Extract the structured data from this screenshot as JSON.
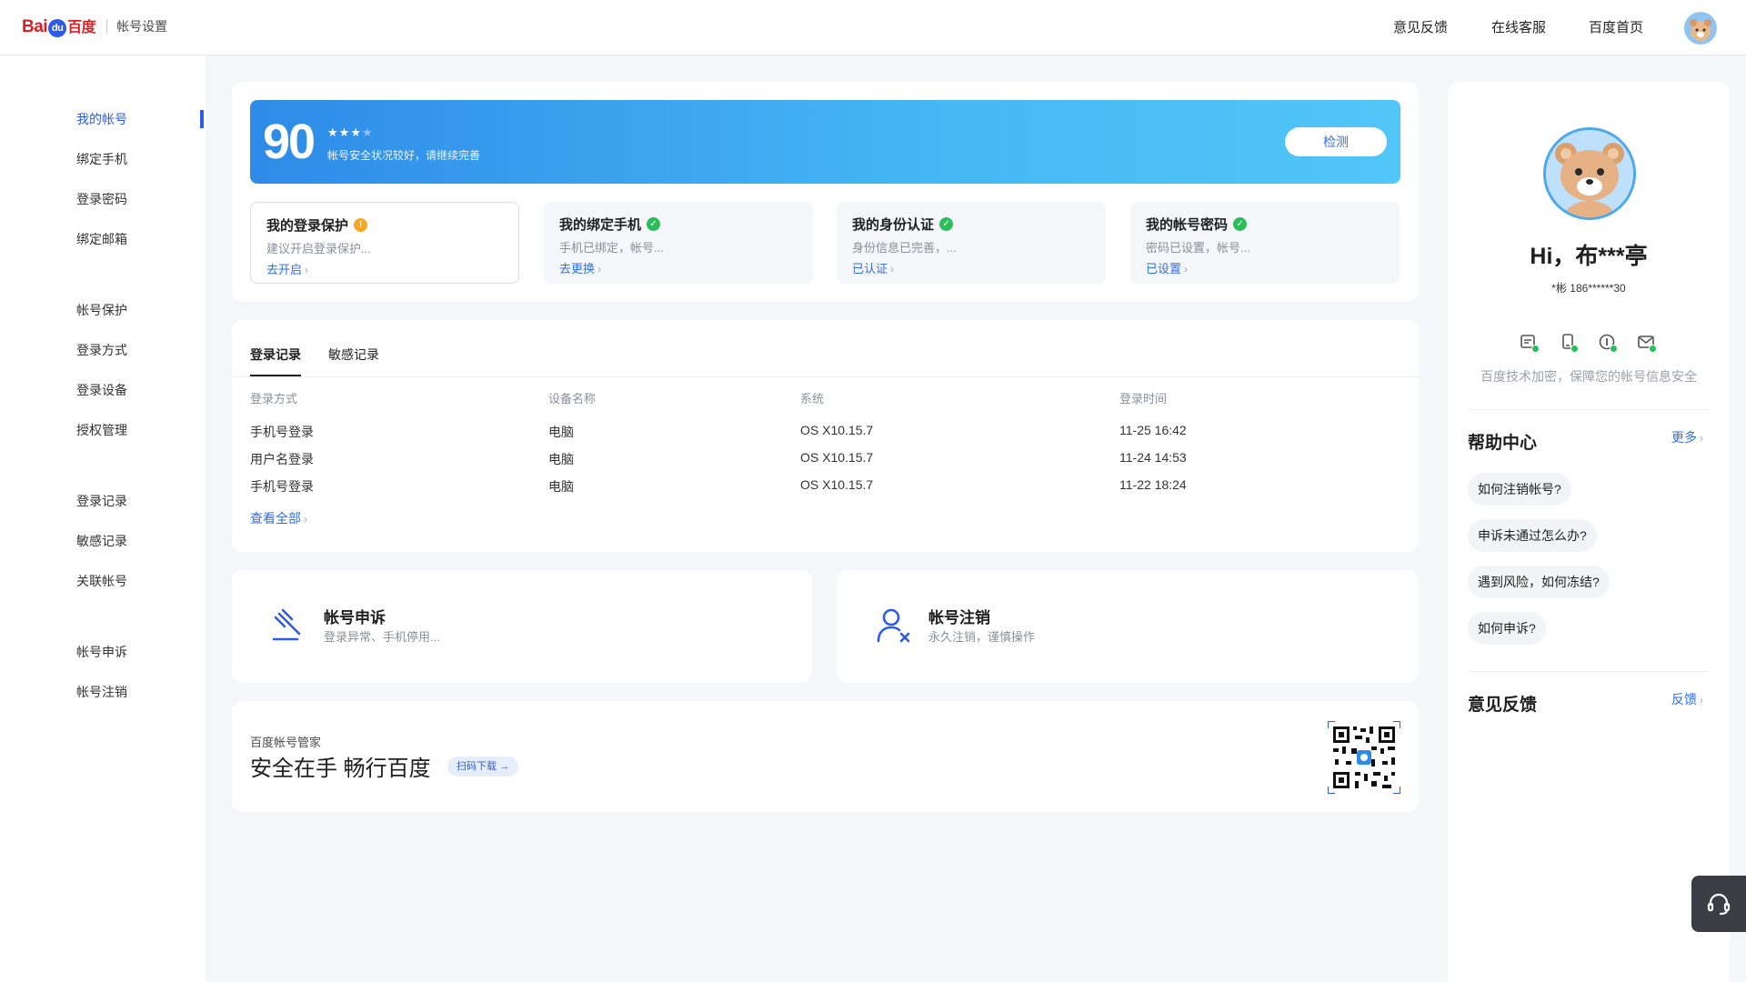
{
  "header": {
    "logo_part1": "Bai",
    "logo_part2": "du",
    "logo_part3": "百度",
    "subtitle": "帐号设置",
    "nav": [
      "意见反馈",
      "在线客服",
      "百度首页"
    ]
  },
  "sidebar": {
    "groups": [
      [
        "我的帐号",
        "绑定手机",
        "登录密码",
        "绑定邮箱"
      ],
      [
        "帐号保护",
        "登录方式",
        "登录设备",
        "授权管理"
      ],
      [
        "登录记录",
        "敏感记录",
        "关联帐号"
      ],
      [
        "帐号申诉",
        "帐号注销"
      ]
    ],
    "active": "我的帐号"
  },
  "security": {
    "score": "90",
    "stars_total": 4,
    "stars_filled": 3,
    "description": "帐号安全状况较好，请继续完善",
    "detect_label": "检测",
    "items": [
      {
        "title": "我的登录保护",
        "status": "warning",
        "desc": "建议开启登录保护...",
        "link": "去开启"
      },
      {
        "title": "我的绑定手机",
        "status": "ok",
        "desc": "手机已绑定，帐号...",
        "link": "去更换"
      },
      {
        "title": "我的身份认证",
        "status": "ok",
        "desc": "身份信息已完善，...",
        "link": "已认证"
      },
      {
        "title": "我的帐号密码",
        "status": "ok",
        "desc": "密码已设置，帐号...",
        "link": "已设置"
      }
    ]
  },
  "records": {
    "tabs": [
      "登录记录",
      "敏感记录"
    ],
    "columns": [
      "登录方式",
      "设备名称",
      "系统",
      "登录时间"
    ],
    "rows": [
      [
        "手机号登录",
        "电脑",
        "OS X10.15.7",
        "11-25 16:42"
      ],
      [
        "用户名登录",
        "电脑",
        "OS X10.15.7",
        "11-24 14:53"
      ],
      [
        "手机号登录",
        "电脑",
        "OS X10.15.7",
        "11-22 18:24"
      ]
    ],
    "view_all": "查看全部"
  },
  "actions": {
    "appeal": {
      "title": "帐号申诉",
      "desc": "登录异常、手机停用..."
    },
    "cancel": {
      "title": "帐号注销",
      "desc": "永久注销，谨慎操作"
    }
  },
  "download": {
    "sub": "百度帐号管家",
    "title": "安全在手 畅行百度",
    "button": "扫码下载"
  },
  "profile": {
    "greeting": "Hi，布***亭",
    "phone": "*彬 186******30",
    "secure_note": "百度技术加密，保障您的帐号信息安全"
  },
  "help": {
    "title": "帮助中心",
    "more": "更多",
    "questions": [
      "如何注销帐号?",
      "申诉未通过怎么办?",
      "遇到风险，如何冻结?",
      "如何申诉?"
    ]
  },
  "feedback": {
    "title": "意见反馈",
    "link": "反馈"
  },
  "colors": {
    "accent": "#2e5ce6",
    "ok": "#2bbd5a",
    "warning": "#f5a623",
    "banner_start": "#2e8be8",
    "banner_end": "#52c6f7"
  }
}
